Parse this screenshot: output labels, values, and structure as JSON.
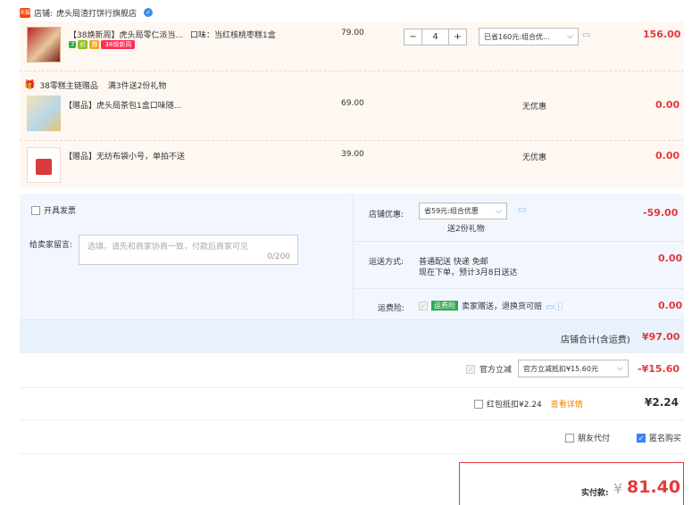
{
  "store": {
    "label": "店铺:",
    "name": "虎头局渣打饼行旗舰店",
    "badge": "天猫"
  },
  "items": [
    {
      "title": "【38焕新周】虎头局零仁派当...",
      "tags": [
        "7",
        "价",
        "券"
      ],
      "promo_tag": "38焕新周",
      "spec": "口味：当红核桃枣糕1盒",
      "price": "79.00",
      "quantity": "4",
      "discount_select": "已省160元:组合优...",
      "subtotal": "156.00"
    }
  ],
  "gift_group": {
    "label": "38零糕主链赠品",
    "rule": "满3件送2份礼物"
  },
  "gifts": [
    {
      "title": "【赠品】虎头局茶包1盒口味随...",
      "price": "69.00",
      "discount": "无优惠",
      "subtotal": "0.00"
    },
    {
      "title": "【赠品】无纺布袋小号，单拍不送",
      "price": "39.00",
      "discount": "无优惠",
      "subtotal": "0.00"
    }
  ],
  "invoice": {
    "label": "开具发票"
  },
  "message": {
    "label": "给卖家留言:",
    "placeholder": "选填，请先和商家协商一致，付款后商家可见",
    "counter": "0/200"
  },
  "store_discount": {
    "label": "店铺优惠:",
    "select": "省59元:组合优惠",
    "note": "送2份礼物",
    "amount": "-59.00"
  },
  "delivery": {
    "label": "运送方式:",
    "method": "普通配送 快递 免邮",
    "eta": "现在下单，预计3月8日送达",
    "amount": "0.00"
  },
  "insurance": {
    "label": "运费险:",
    "badge": "运费险",
    "desc": "卖家赠送，退换货可赔",
    "amount": "0.00"
  },
  "store_total": {
    "label": "店铺合计(含运费)",
    "amount": "¥97.00"
  },
  "official_discount": {
    "label": "官方立减",
    "select": "官方立减抵扣¥15.60元",
    "amount": "-¥15.60"
  },
  "red_packet": {
    "label": "红包抵扣¥2.24",
    "link": "查看详情",
    "amount": "¥2.24"
  },
  "options": {
    "friend_pay": "朋友代付",
    "anonymous": "匿名购买"
  },
  "payment": {
    "label": "实付款:",
    "currency": "¥",
    "amount": "81.40"
  },
  "colors": {
    "accent_red": "#e4393c",
    "link_orange": "#f08300",
    "panel_blue": "#f2f7ff"
  }
}
